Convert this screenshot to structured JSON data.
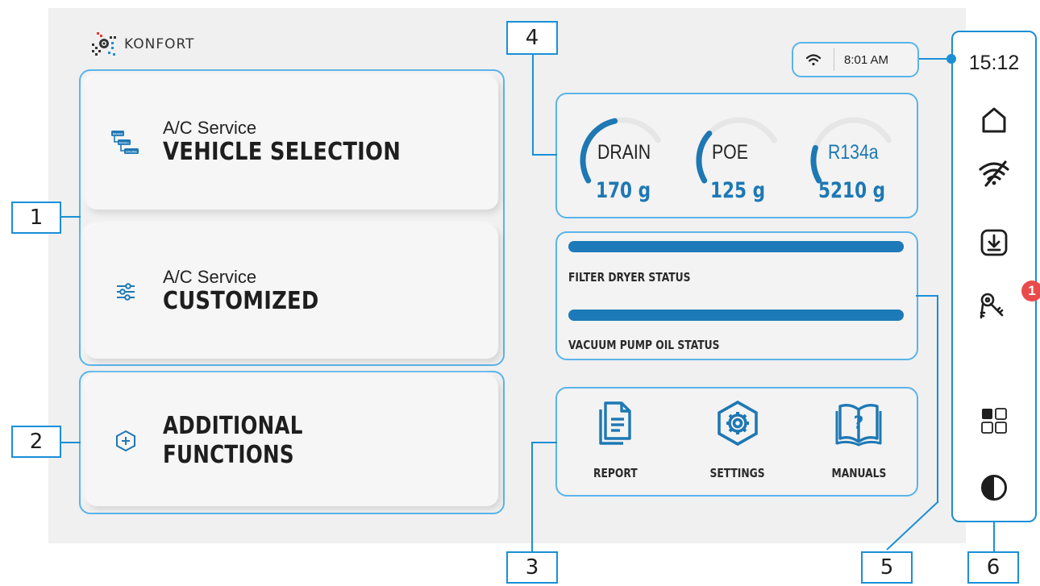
{
  "brand": {
    "name": "KONFORT"
  },
  "status_bar": {
    "time": "8:01 AM",
    "wifi_icon": "wifi-icon"
  },
  "cards": [
    {
      "subtitle": "A/C Service",
      "title": "VEHICLE SELECTION",
      "icon": "brand-model-engine-icon",
      "icon_labels": [
        "BRAND",
        "MODEL",
        "ENGINE"
      ]
    },
    {
      "subtitle": "A/C Service",
      "title": "CUSTOMIZED",
      "icon": "sliders-icon"
    },
    {
      "title": "ADDITIONAL FUNCTIONS",
      "icon": "plus-hexagon-icon"
    }
  ],
  "gauges": [
    {
      "label": "DRAIN",
      "value": "170 g",
      "level": 0.45
    },
    {
      "label": "POE",
      "value": "125 g",
      "level": 0.3
    },
    {
      "label": "R134a",
      "value": "5210 g",
      "level": 0.2
    }
  ],
  "status": [
    {
      "label": "FILTER DRYER STATUS",
      "level": 1.0
    },
    {
      "label": "VACUUM PUMP OIL STATUS",
      "level": 1.0
    }
  ],
  "apps": [
    {
      "label": "REPORT",
      "icon": "report-icon"
    },
    {
      "label": "SETTINGS",
      "icon": "settings-icon"
    },
    {
      "label": "MANUALS",
      "icon": "manuals-icon"
    }
  ],
  "sidebar": {
    "clock": "15:12",
    "items": [
      "home-icon",
      "wifi-off-icon",
      "download-icon",
      "keys-icon",
      "grid-icon",
      "contrast-icon"
    ],
    "badge_count": "1"
  },
  "callouts": [
    "1",
    "2",
    "3",
    "4",
    "5",
    "6"
  ],
  "colors": {
    "accent": "#1d78b4",
    "callout": "#1a8fd6",
    "badge": "#e94b4b",
    "screen_bg": "#f0f0f0"
  }
}
